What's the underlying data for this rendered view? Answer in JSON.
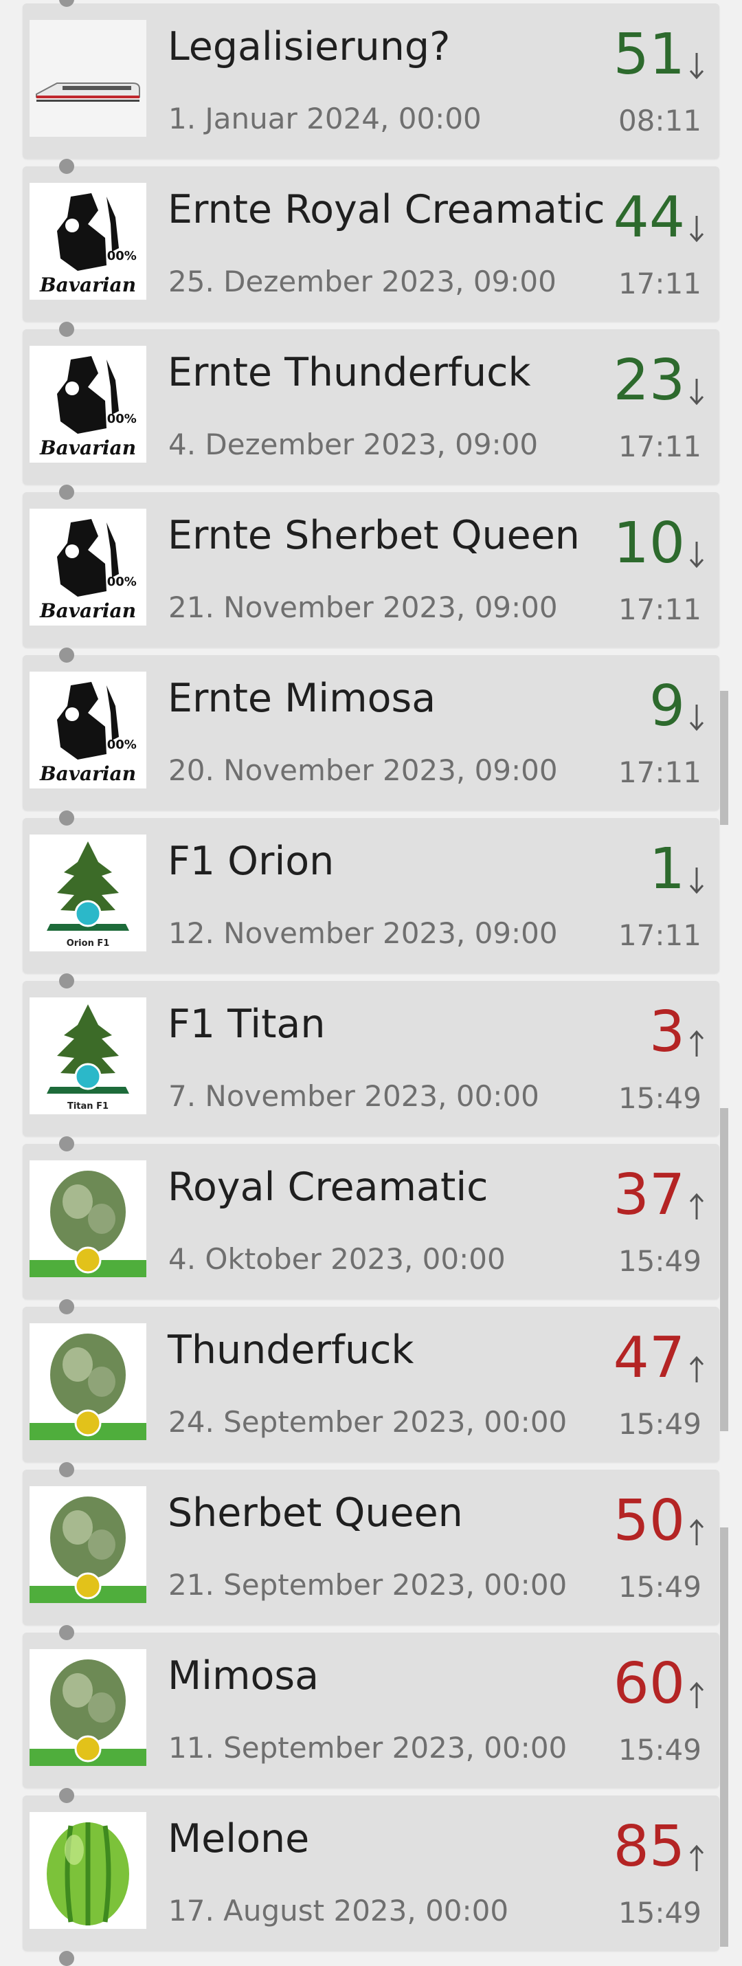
{
  "events": [
    {
      "title": "Legalisierung?",
      "date": "1. Januar 2024, 00:00",
      "count": "51",
      "trend": "down",
      "time": "08:11",
      "icon": "train-icon"
    },
    {
      "title": "Ernte Royal Creamatic",
      "date": "25. Dezember 2023, 09:00",
      "count": "44",
      "trend": "down",
      "time": "17:11",
      "icon": "bavarian-logo-icon",
      "logo_text": "100%",
      "logo_word": "Bavarian"
    },
    {
      "title": "Ernte Thunderfuck",
      "date": "4. Dezember 2023, 09:00",
      "count": "23",
      "trend": "down",
      "time": "17:11",
      "icon": "bavarian-logo-icon",
      "logo_text": "100%",
      "logo_word": "Bavarian"
    },
    {
      "title": "Ernte Sherbet Queen",
      "date": "21. November 2023, 09:00",
      "count": "10",
      "trend": "down",
      "time": "17:11",
      "icon": "bavarian-logo-icon",
      "logo_text": "100%",
      "logo_word": "Bavarian"
    },
    {
      "title": "Ernte Mimosa",
      "date": "20. November 2023, 09:00",
      "count": "9",
      "trend": "down",
      "time": "17:11",
      "icon": "bavarian-logo-icon",
      "logo_text": "100%",
      "logo_word": "Bavarian"
    },
    {
      "title": "F1 Orion",
      "date": "12. November 2023, 09:00",
      "count": "1",
      "trend": "down",
      "time": "17:11",
      "icon": "plant-icon",
      "caption": "Orion F1"
    },
    {
      "title": "F1 Titan",
      "date": "7. November 2023, 00:00",
      "count": "3",
      "trend": "up",
      "time": "15:49",
      "icon": "plant-icon",
      "caption": "Titan F1"
    },
    {
      "title": "Royal Creamatic",
      "date": "4. Oktober 2023, 00:00",
      "count": "37",
      "trend": "up",
      "time": "15:49",
      "icon": "cannabis-bud-icon"
    },
    {
      "title": "Thunderfuck",
      "date": "24. September 2023, 00:00",
      "count": "47",
      "trend": "up",
      "time": "15:49",
      "icon": "cannabis-bud-icon"
    },
    {
      "title": "Sherbet Queen",
      "date": "21. September 2023, 00:00",
      "count": "50",
      "trend": "up",
      "time": "15:49",
      "icon": "cannabis-bud-icon"
    },
    {
      "title": "Mimosa",
      "date": "11. September 2023, 00:00",
      "count": "60",
      "trend": "up",
      "time": "15:49",
      "icon": "cannabis-bud-icon"
    },
    {
      "title": "Melone",
      "date": "17. August 2023, 00:00",
      "count": "85",
      "trend": "up",
      "time": "15:49",
      "icon": "melon-icon"
    }
  ],
  "colors": {
    "down": "#2d6a2d",
    "up": "#b42424",
    "card": "#e0e0e0",
    "background": "#f1f1f1"
  }
}
